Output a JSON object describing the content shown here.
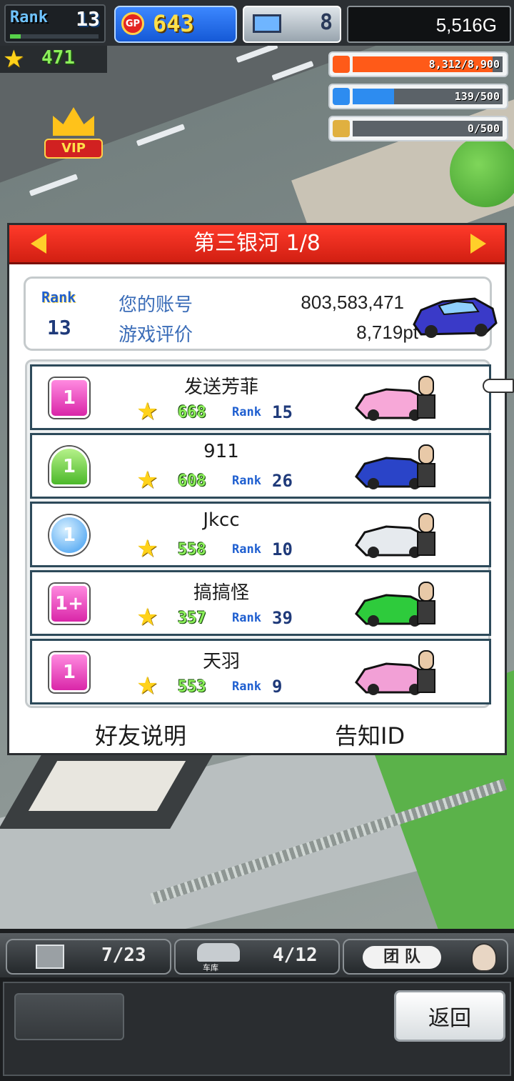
{
  "hud": {
    "rank_label": "Rank",
    "rank_value": "13",
    "rank_progress": 0.12,
    "gp_coin": "GP",
    "gp_value": "643",
    "pc_value": "8",
    "gold_value": "5,516G",
    "stars_value": "471"
  },
  "vip": {
    "label": "VIP"
  },
  "resources": [
    {
      "icon": "coin-stack-icon",
      "text": "8,312/8,900",
      "fraction": 0.934,
      "color": "#ff5a18"
    },
    {
      "icon": "bottle-icon",
      "text": "139/500",
      "fraction": 0.278,
      "color": "#2d8cf0"
    },
    {
      "icon": "wheat-icon",
      "text": "0/500",
      "fraction": 0.0,
      "color": "#e0b040"
    }
  ],
  "panel": {
    "title": "第三银河 1/8",
    "account": {
      "rank_label": "Rank",
      "rank_value": "13",
      "id_label": "您的账号",
      "id_value": "803,583,471",
      "rating_label": "游戏评价",
      "rating_value": "8,719pt"
    },
    "friends": [
      {
        "name": "发送芳菲",
        "badge": "1",
        "badge_style": "pink",
        "score": "668",
        "rank_label": "Rank",
        "rank": "15",
        "car_color": "#f7a8d8"
      },
      {
        "name": "911",
        "badge": "1",
        "badge_style": "green",
        "score": "608",
        "rank_label": "Rank",
        "rank": "26",
        "car_color": "#2a44c8"
      },
      {
        "name": "Jkcc",
        "badge": "1",
        "badge_style": "blue",
        "score": "558",
        "rank_label": "Rank",
        "rank": "10",
        "car_color": "#e6eaee"
      },
      {
        "name": "搞搞怪",
        "badge": "1+",
        "badge_style": "pink",
        "score": "357",
        "rank_label": "Rank",
        "rank": "39",
        "car_color": "#2ecb3c"
      },
      {
        "name": "天羽",
        "badge": "1",
        "badge_style": "pink",
        "score": "553",
        "rank_label": "Rank",
        "rank": "9",
        "car_color": "#f2a0d6"
      }
    ],
    "links": {
      "help": "好友说明",
      "notify": "告知ID"
    }
  },
  "bottom": {
    "tab1_value": "7/23",
    "tab2_label": "车库",
    "tab2_value": "4/12",
    "team_label": "团 队",
    "back_label": "返回"
  }
}
